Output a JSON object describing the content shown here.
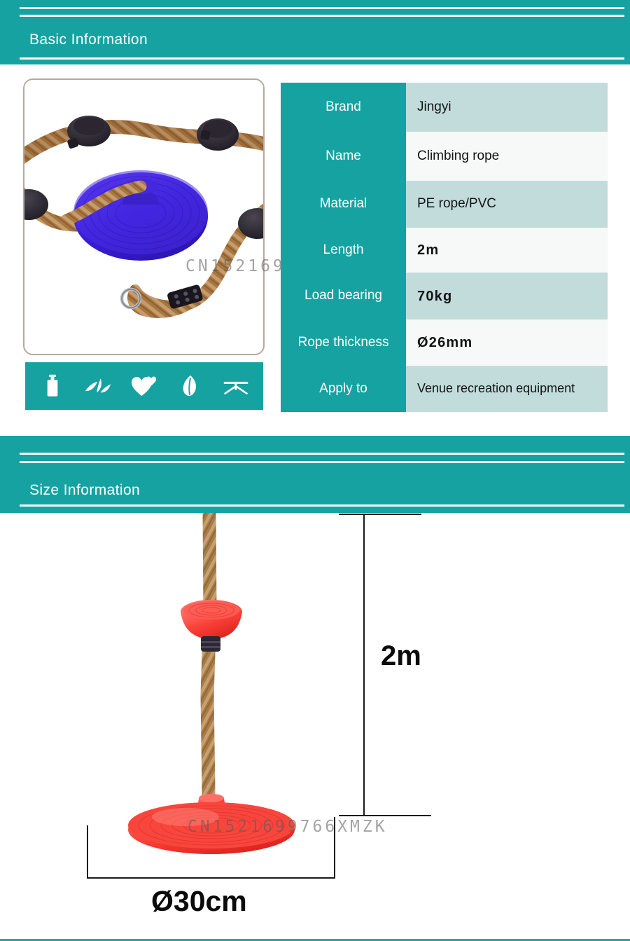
{
  "theme": {
    "teal": "#17a2a2",
    "row_alt": "#c2dcdc",
    "row_base": "#f7f8f8",
    "photo_border": "#b9a79e"
  },
  "sections": {
    "basic": {
      "title": "Basic Information"
    },
    "size": {
      "title": "Size Information"
    }
  },
  "product_photo": {
    "alt": "Blue disc climbing rope swing with brown braided rope, black discs and metal ring"
  },
  "feature_icons": [
    {
      "name": "bottle-icon",
      "label": "container"
    },
    {
      "name": "grass-icon",
      "label": "grass leaves"
    },
    {
      "name": "hearts-icon",
      "label": "hearts"
    },
    {
      "name": "leaf-icon",
      "label": "leaf"
    },
    {
      "name": "sprout-icon",
      "label": "open sprout"
    }
  ],
  "spec_table": {
    "rows": [
      {
        "label": "Brand",
        "value": "Jingyi",
        "style": "alt",
        "bold": false
      },
      {
        "label": "Name",
        "value": "Climbing rope",
        "style": "base",
        "bold": false
      },
      {
        "label": "Material",
        "value": "PE rope/PVC",
        "style": "alt",
        "bold": false
      },
      {
        "label": "Length",
        "value": "2m",
        "style": "base",
        "bold": true
      },
      {
        "label": "Load bearing",
        "value": "70kg",
        "style": "alt",
        "bold": true
      },
      {
        "label": "Rope thickness",
        "value": "Ø26mm",
        "style": "base",
        "bold": true
      },
      {
        "label": "Apply to",
        "value": "Venue recreation equipment",
        "style": "alt",
        "bold": false
      }
    ]
  },
  "size_diagram": {
    "height_label": "2m",
    "diameter_label": "Ø30cm",
    "alt": "Vertical climbing rope with red disc seat at bottom and red disc step"
  },
  "watermarks": {
    "text": "CN1521699766XMZK"
  }
}
